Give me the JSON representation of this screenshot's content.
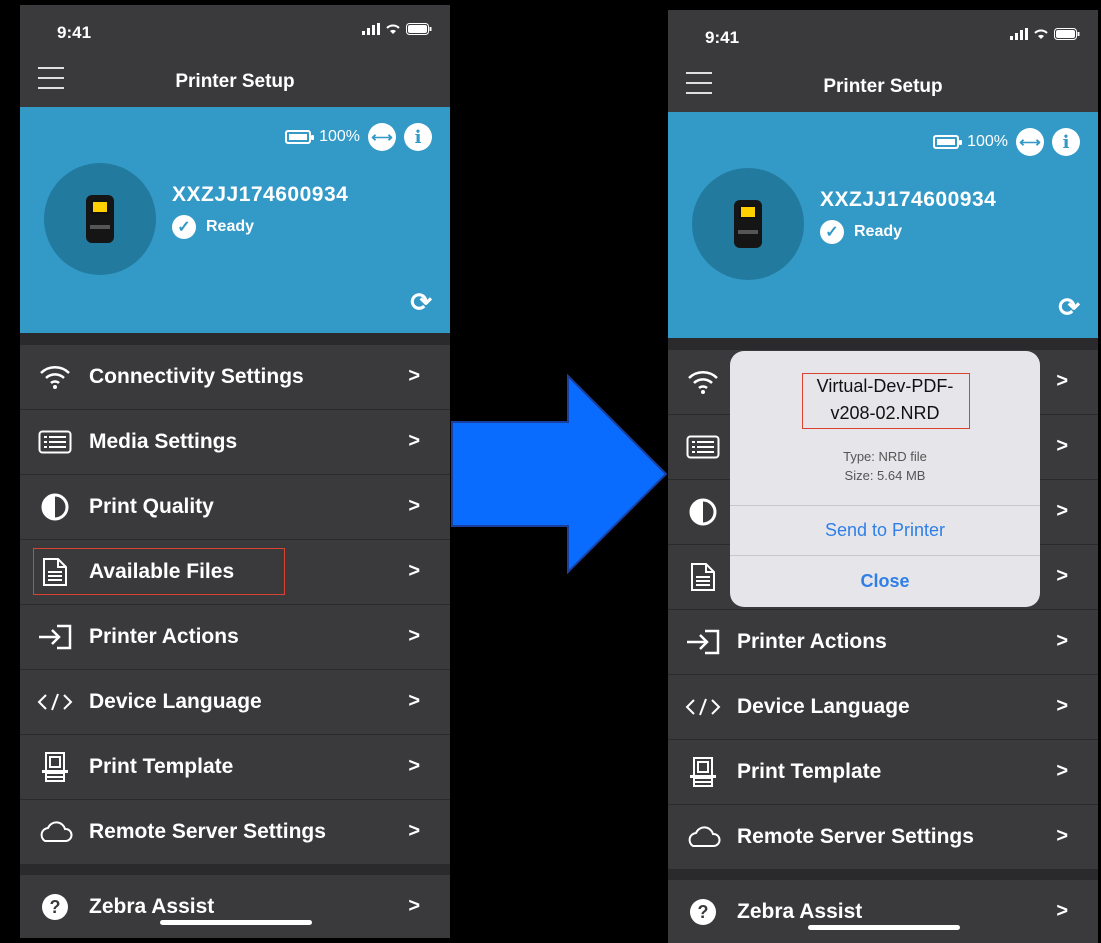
{
  "status": {
    "time": "9:41"
  },
  "nav": {
    "title": "Printer Setup"
  },
  "device": {
    "battery_percent": "100%",
    "serial": "XXZJJ174600934",
    "status": "Ready"
  },
  "menu": {
    "items": [
      {
        "label": "Connectivity Settings",
        "icon": "wifi-icon"
      },
      {
        "label": "Media Settings",
        "icon": "media-icon"
      },
      {
        "label": "Print Quality",
        "icon": "contrast-icon"
      },
      {
        "label": "Available Files",
        "icon": "file-icon"
      },
      {
        "label": "Printer Actions",
        "icon": "printer-actions-icon"
      },
      {
        "label": "Device Language",
        "icon": "code-icon"
      },
      {
        "label": "Print Template",
        "icon": "print-template-icon"
      },
      {
        "label": "Remote Server Settings",
        "icon": "cloud-icon"
      }
    ],
    "assist": {
      "label": "Zebra Assist",
      "icon": "help-icon"
    }
  },
  "dialog": {
    "file_name_line1": "Virtual-Dev-PDF-",
    "file_name_line2": "v208-02.NRD",
    "type": "Type: NRD file",
    "size": "Size: 5.64 MB",
    "send_label": "Send to Printer",
    "close_label": "Close"
  },
  "colors": {
    "header_blue": "#3399c7",
    "menu_bg": "#3a3a3c",
    "arrow_blue": "#0a6cff",
    "highlight_red": "#d9432f",
    "link_blue": "#2f7fe6"
  }
}
